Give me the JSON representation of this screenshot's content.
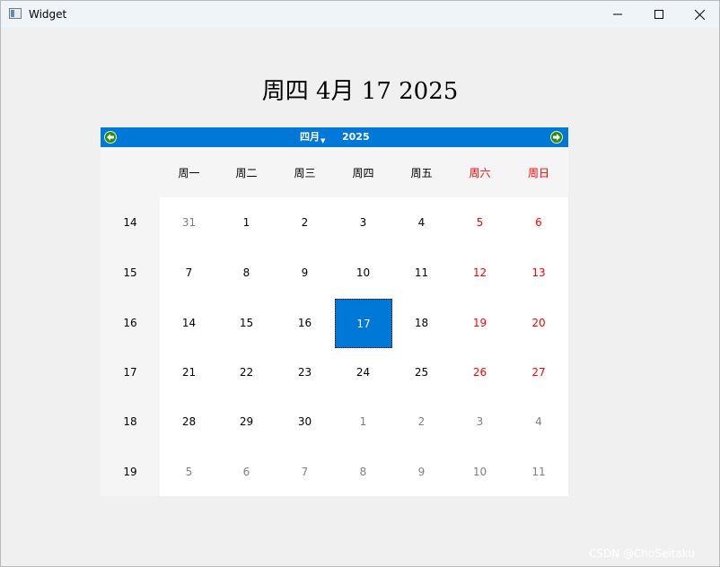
{
  "window": {
    "title": "Widget"
  },
  "date_label": "周四 4月 17 2025",
  "calendar": {
    "month": "四月",
    "year": "2025",
    "weekdays": [
      "周一",
      "周二",
      "周三",
      "周四",
      "周五",
      "周六",
      "周日"
    ],
    "weekend_color": "#ff0000",
    "selection_color": "#0078d7",
    "weeks": [
      {
        "number": "14",
        "days": [
          {
            "label": "31",
            "type": "other"
          },
          {
            "label": "1",
            "type": "current"
          },
          {
            "label": "2",
            "type": "current"
          },
          {
            "label": "3",
            "type": "current"
          },
          {
            "label": "4",
            "type": "current"
          },
          {
            "label": "5",
            "type": "weekend"
          },
          {
            "label": "6",
            "type": "weekend"
          }
        ]
      },
      {
        "number": "15",
        "days": [
          {
            "label": "7",
            "type": "current"
          },
          {
            "label": "8",
            "type": "current"
          },
          {
            "label": "9",
            "type": "current"
          },
          {
            "label": "10",
            "type": "current"
          },
          {
            "label": "11",
            "type": "current"
          },
          {
            "label": "12",
            "type": "weekend"
          },
          {
            "label": "13",
            "type": "weekend"
          }
        ]
      },
      {
        "number": "16",
        "days": [
          {
            "label": "14",
            "type": "current"
          },
          {
            "label": "15",
            "type": "current"
          },
          {
            "label": "16",
            "type": "current"
          },
          {
            "label": "17",
            "type": "selected"
          },
          {
            "label": "18",
            "type": "current"
          },
          {
            "label": "19",
            "type": "weekend"
          },
          {
            "label": "20",
            "type": "weekend"
          }
        ]
      },
      {
        "number": "17",
        "days": [
          {
            "label": "21",
            "type": "current"
          },
          {
            "label": "22",
            "type": "current"
          },
          {
            "label": "23",
            "type": "current"
          },
          {
            "label": "24",
            "type": "current"
          },
          {
            "label": "25",
            "type": "current"
          },
          {
            "label": "26",
            "type": "weekend"
          },
          {
            "label": "27",
            "type": "weekend"
          }
        ]
      },
      {
        "number": "18",
        "days": [
          {
            "label": "28",
            "type": "current"
          },
          {
            "label": "29",
            "type": "current"
          },
          {
            "label": "30",
            "type": "current"
          },
          {
            "label": "1",
            "type": "other"
          },
          {
            "label": "2",
            "type": "other"
          },
          {
            "label": "3",
            "type": "other"
          },
          {
            "label": "4",
            "type": "other"
          }
        ]
      },
      {
        "number": "19",
        "days": [
          {
            "label": "5",
            "type": "other"
          },
          {
            "label": "6",
            "type": "other"
          },
          {
            "label": "7",
            "type": "other"
          },
          {
            "label": "8",
            "type": "other"
          },
          {
            "label": "9",
            "type": "other"
          },
          {
            "label": "10",
            "type": "other"
          },
          {
            "label": "11",
            "type": "other"
          }
        ]
      }
    ]
  },
  "watermark": "CSDN @ChoSeitaku"
}
